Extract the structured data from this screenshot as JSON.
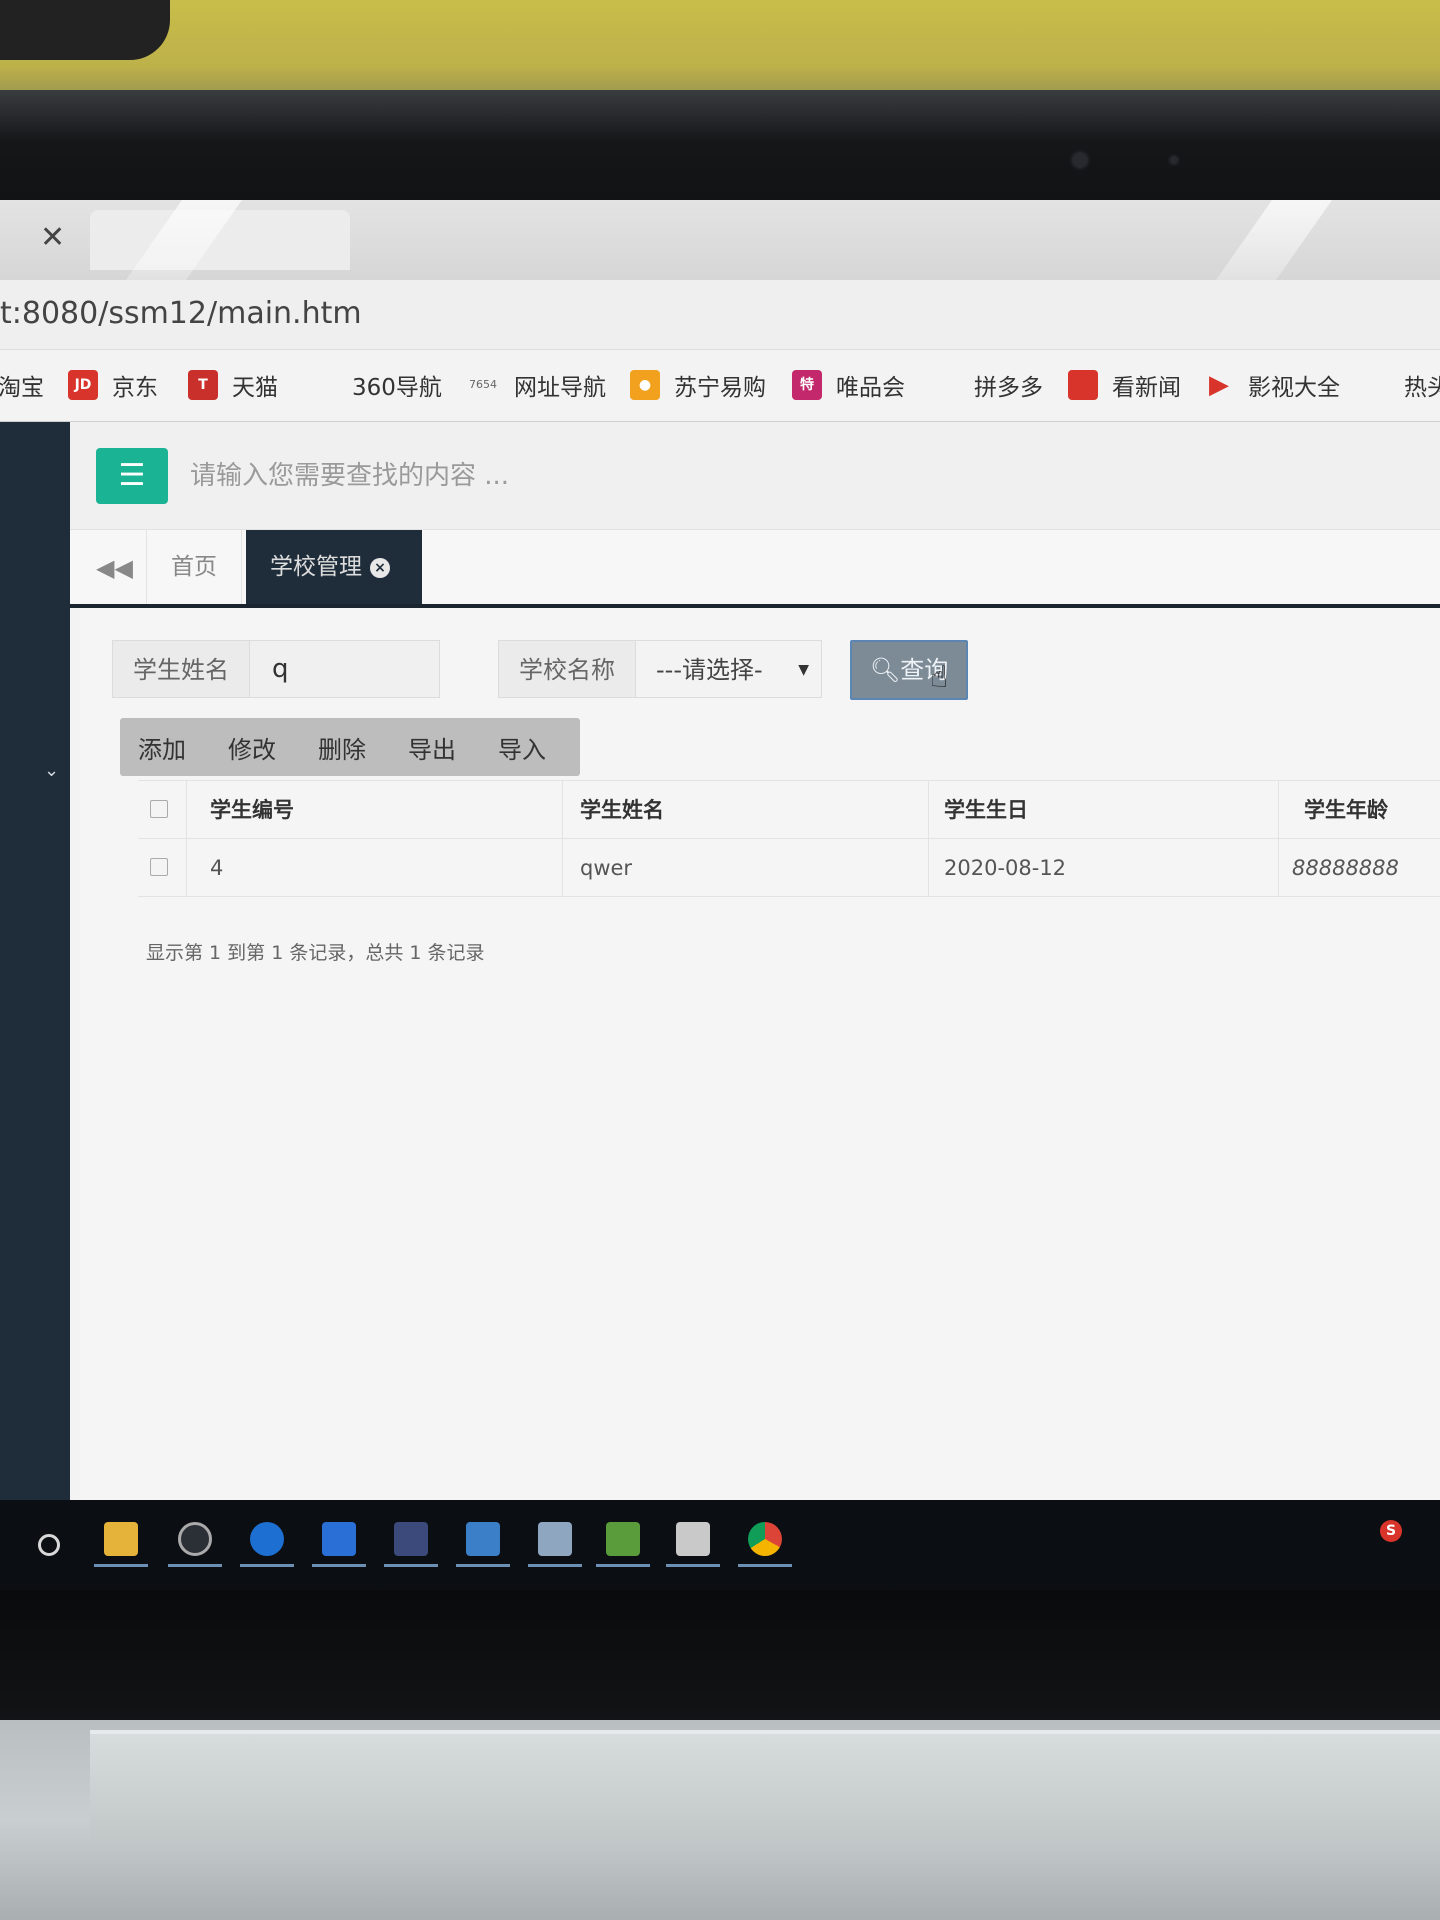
{
  "browser": {
    "url": "t:8080/ssm12/main.htm",
    "bookmarks": [
      {
        "label": "淘宝",
        "icon": "taobao-icon",
        "color": ""
      },
      {
        "label": "京东",
        "icon": "jd-icon",
        "icon_text": "JD",
        "color": "#d9342b"
      },
      {
        "label": "天猫",
        "icon": "tmall-icon",
        "icon_text": "T",
        "color": "#c9302c"
      },
      {
        "label": "360导航",
        "icon": "",
        "color": ""
      },
      {
        "label": "网址导航",
        "icon": "7654-icon",
        "icon_text": "7654",
        "color": ""
      },
      {
        "label": "苏宁易购",
        "icon": "suning-icon",
        "color": "#f2a11f"
      },
      {
        "label": "唯品会",
        "icon": "vip-icon",
        "icon_text": "特",
        "color": "#c4286c"
      },
      {
        "label": "拼多多",
        "icon": "",
        "color": ""
      },
      {
        "label": "看新闻",
        "icon": "news-icon",
        "color": "#d9342b"
      },
      {
        "label": "影视大全",
        "icon": "video-icon",
        "color": "#d9342b"
      },
      {
        "label": "热头",
        "icon": "",
        "color": ""
      }
    ]
  },
  "topbar": {
    "search_placeholder": "请输入您需要查找的内容 ..."
  },
  "tabs": {
    "home": "首页",
    "active": "学校管理"
  },
  "filters": {
    "student_name_label": "学生姓名",
    "student_name_value": "q",
    "school_name_label": "学校名称",
    "school_name_selected": "---请选择-",
    "query_label": "查询"
  },
  "toolbar": {
    "add": "添加",
    "edit": "修改",
    "delete": "删除",
    "export": "导出",
    "import": "导入"
  },
  "table": {
    "headers": [
      "学生编号",
      "学生姓名",
      "学生生日",
      "学生年龄"
    ],
    "rows": [
      [
        "4",
        "qwer",
        "2020-08-12",
        "88888888"
      ]
    ]
  },
  "summary": "显示第 1 到第 1 条记录，总共 1 条记录",
  "colors": {
    "accent_green": "#1ab394",
    "sidebar_dark": "#1f2d3a"
  }
}
